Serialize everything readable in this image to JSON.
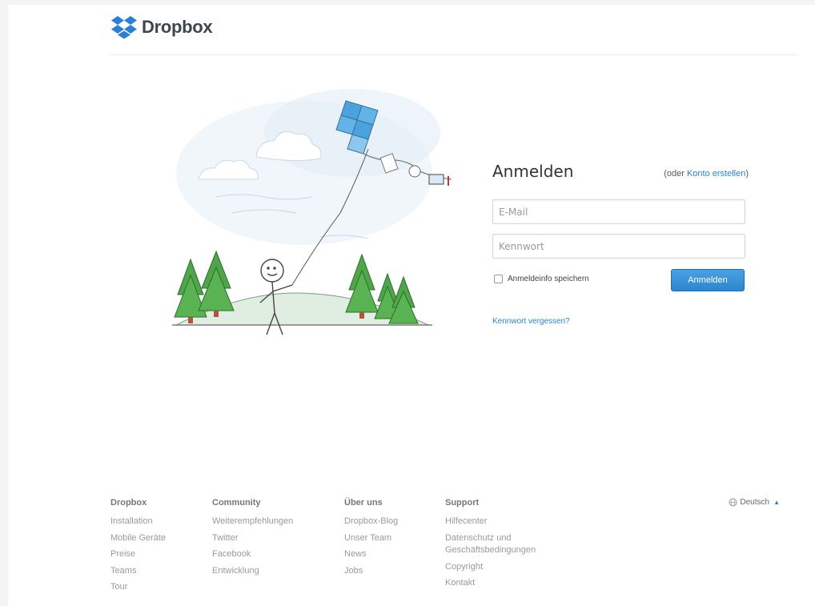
{
  "brand": {
    "name": "Dropbox"
  },
  "login": {
    "title": "Anmelden",
    "create_prefix": "(oder ",
    "create_link": "Konto erstellen",
    "create_suffix": ")",
    "email_placeholder": "E-Mail",
    "password_placeholder": "Kennwort",
    "remember_label": "Anmeldeinfo speichern",
    "submit_label": "Anmelden",
    "forgot_label": "Kennwort vergessen?"
  },
  "footer": {
    "columns": [
      {
        "heading": "Dropbox",
        "links": [
          "Installation",
          "Mobile Geräte",
          "Preise",
          "Teams",
          "Tour"
        ]
      },
      {
        "heading": "Community",
        "links": [
          "Weiterempfehlungen",
          "Twitter",
          "Facebook",
          "Entwicklung"
        ]
      },
      {
        "heading": "Über uns",
        "links": [
          "Dropbox-Blog",
          "Unser Team",
          "News",
          "Jobs"
        ]
      },
      {
        "heading": "Support",
        "links": [
          "Hilfecenter",
          "Datenschutz und",
          "Geschäftsbedingungen",
          "Copyright",
          "Kontakt"
        ]
      }
    ],
    "language": "Deutsch"
  },
  "colors": {
    "accent": "#2a83d2",
    "button": "#3593da",
    "logo_blue": "#2b7fd4"
  },
  "icons": [
    "dropbox-logo-icon",
    "globe-icon",
    "caret-up-icon"
  ]
}
